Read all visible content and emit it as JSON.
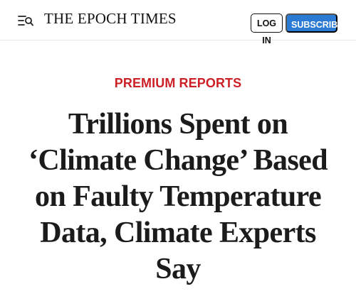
{
  "header": {
    "brand": "THE EPOCH TIMES",
    "login_label": "LOG IN",
    "subscribe_label": "SUBSCRIBE",
    "menu_icon": "menu-search-icon"
  },
  "article": {
    "category": "PREMIUM REPORTS",
    "headline": "Trillions Spent on ‘Climate Change’ Based on Faulty Temperature Data, Climate Experts Say"
  },
  "colors": {
    "accent_red": "#cc1f26",
    "subscribe_blue": "#2b7bd4",
    "text_dark": "#1b1b1b"
  }
}
